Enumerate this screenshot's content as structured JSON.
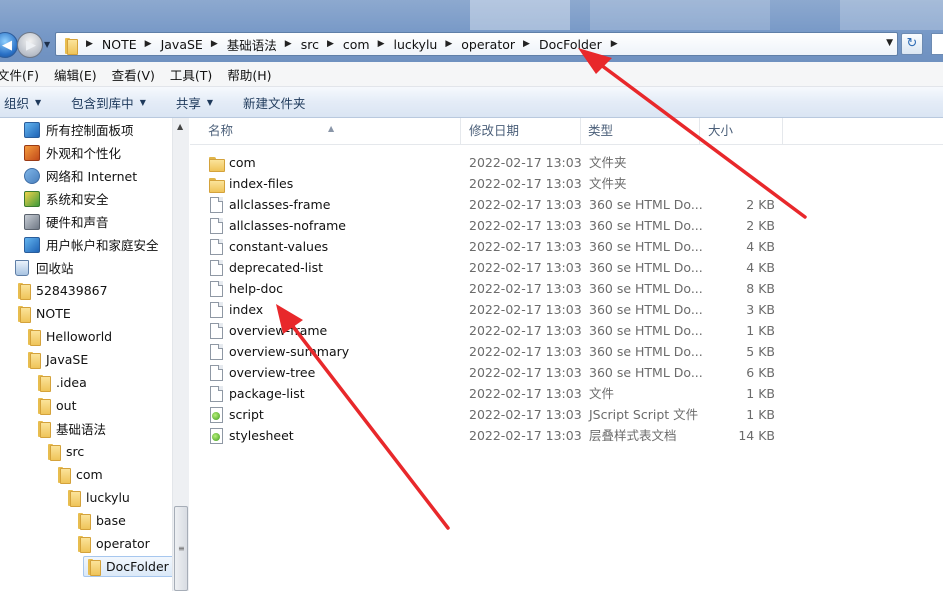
{
  "breadcrumb": [
    "NOTE",
    "JavaSE",
    "基础语法",
    "src",
    "com",
    "luckylu",
    "operator",
    "DocFolder"
  ],
  "menu": [
    "文件(F)",
    "编辑(E)",
    "查看(V)",
    "工具(T)",
    "帮助(H)"
  ],
  "toolbar": {
    "organize": "组织",
    "include": "包含到库中",
    "share": "共享",
    "new_folder": "新建文件夹"
  },
  "nav": [
    {
      "label": "所有控制面板项",
      "icon": "control-panel-icon"
    },
    {
      "label": "外观和个性化",
      "icon": "appearance-icon"
    },
    {
      "label": "网络和 Internet",
      "icon": "network-icon"
    },
    {
      "label": "系统和安全",
      "icon": "system-security-icon"
    },
    {
      "label": "硬件和声音",
      "icon": "hardware-sound-icon"
    },
    {
      "label": "用户帐户和家庭安全",
      "icon": "user-accounts-icon"
    },
    {
      "label": "回收站",
      "icon": "recycle-bin-icon"
    },
    {
      "label": "528439867",
      "icon": "folder-icon"
    },
    {
      "label": "NOTE",
      "icon": "folder-icon"
    },
    {
      "label": "Helloworld",
      "icon": "folder-icon"
    },
    {
      "label": "JavaSE",
      "icon": "folder-icon"
    },
    {
      "label": ".idea",
      "icon": "folder-icon"
    },
    {
      "label": "out",
      "icon": "folder-icon"
    },
    {
      "label": "基础语法",
      "icon": "folder-icon"
    },
    {
      "label": "src",
      "icon": "folder-icon"
    },
    {
      "label": "com",
      "icon": "folder-icon"
    },
    {
      "label": "luckylu",
      "icon": "folder-icon"
    },
    {
      "label": "base",
      "icon": "folder-icon"
    },
    {
      "label": "operator",
      "icon": "folder-icon"
    },
    {
      "label": "DocFolder",
      "icon": "folder-icon",
      "selected": true
    }
  ],
  "columns": {
    "name": "名称",
    "date": "修改日期",
    "type": "类型",
    "size": "大小"
  },
  "files": [
    {
      "name": "com",
      "date": "2022-02-17 13:03",
      "type": "文件夹",
      "size": "",
      "icon": "folder-icon"
    },
    {
      "name": "index-files",
      "date": "2022-02-17 13:03",
      "type": "文件夹",
      "size": "",
      "icon": "folder-icon"
    },
    {
      "name": "allclasses-frame",
      "date": "2022-02-17 13:03",
      "type": "360 se HTML Do...",
      "size": "2 KB",
      "icon": "html-file-icon"
    },
    {
      "name": "allclasses-noframe",
      "date": "2022-02-17 13:03",
      "type": "360 se HTML Do...",
      "size": "2 KB",
      "icon": "html-file-icon"
    },
    {
      "name": "constant-values",
      "date": "2022-02-17 13:03",
      "type": "360 se HTML Do...",
      "size": "4 KB",
      "icon": "html-file-icon"
    },
    {
      "name": "deprecated-list",
      "date": "2022-02-17 13:03",
      "type": "360 se HTML Do...",
      "size": "4 KB",
      "icon": "html-file-icon"
    },
    {
      "name": "help-doc",
      "date": "2022-02-17 13:03",
      "type": "360 se HTML Do...",
      "size": "8 KB",
      "icon": "html-file-icon"
    },
    {
      "name": "index",
      "date": "2022-02-17 13:03",
      "type": "360 se HTML Do...",
      "size": "3 KB",
      "icon": "html-file-icon"
    },
    {
      "name": "overview-frame",
      "date": "2022-02-17 13:03",
      "type": "360 se HTML Do...",
      "size": "1 KB",
      "icon": "html-file-icon"
    },
    {
      "name": "overview-summary",
      "date": "2022-02-17 13:03",
      "type": "360 se HTML Do...",
      "size": "5 KB",
      "icon": "html-file-icon"
    },
    {
      "name": "overview-tree",
      "date": "2022-02-17 13:03",
      "type": "360 se HTML Do...",
      "size": "6 KB",
      "icon": "html-file-icon"
    },
    {
      "name": "package-list",
      "date": "2022-02-17 13:03",
      "type": "文件",
      "size": "1 KB",
      "icon": "file-icon"
    },
    {
      "name": "script",
      "date": "2022-02-17 13:03",
      "type": "JScript Script 文件",
      "size": "1 KB",
      "icon": "script-file-icon"
    },
    {
      "name": "stylesheet",
      "date": "2022-02-17 13:03",
      "type": "层叠样式表文档",
      "size": "14 KB",
      "icon": "css-file-icon"
    }
  ],
  "colors": {
    "annotation_arrow": "#e8282b",
    "selection": "#dbe9f8",
    "address_bar": "#7597c6"
  }
}
